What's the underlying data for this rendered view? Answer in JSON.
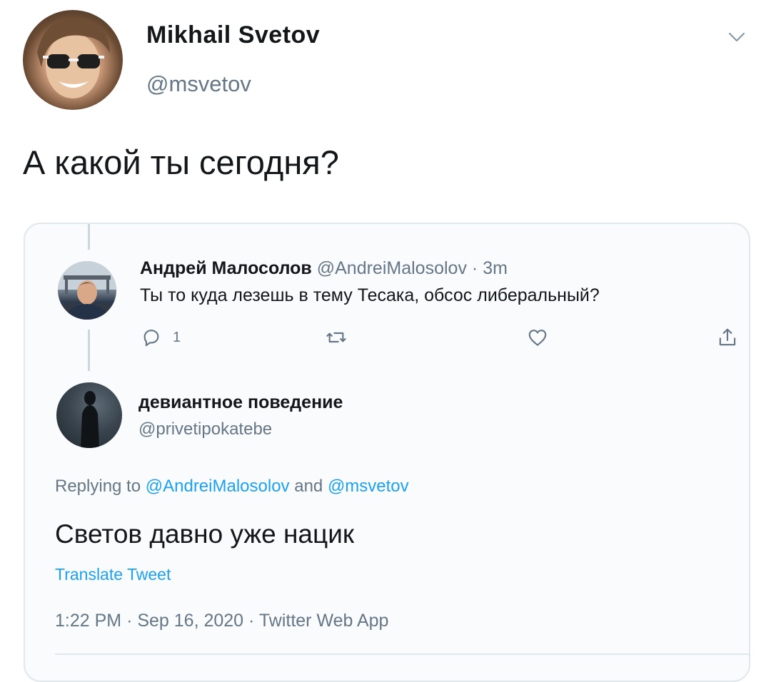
{
  "tweet": {
    "author_name": "Mikhail Svetov",
    "author_handle": "@msvetov",
    "text": "А какой ты сегодня?"
  },
  "quoted": {
    "reply": {
      "author_name": "Андрей Малосолов",
      "author_handle": "@AndreiMalosolov",
      "separator": "·",
      "time": "3m",
      "text": "Ты то куда лезешь в тему Тесака, обсос либеральный?",
      "reply_count": "1"
    },
    "main": {
      "author_name": "девиантное поведение",
      "author_handle": "@privetipokatebe",
      "replying_prefix": "Replying to",
      "replying_mention_1": "@AndreiMalosolov",
      "replying_and": "and",
      "replying_mention_2": "@msvetov",
      "text": "Светов давно уже нацик",
      "translate_label": "Translate Tweet",
      "time": "1:22 PM",
      "date": "Sep 16, 2020",
      "source": "Twitter Web App",
      "meta_separator": "·"
    }
  },
  "icons": {
    "chevron": "chevron-down-icon",
    "reply": "reply-icon",
    "retweet": "retweet-icon",
    "like": "heart-icon",
    "share": "share-icon"
  },
  "colors": {
    "link": "#1da1f2",
    "secondary_text": "#657786",
    "primary_text": "#14171a",
    "border": "#e1e8ed"
  }
}
